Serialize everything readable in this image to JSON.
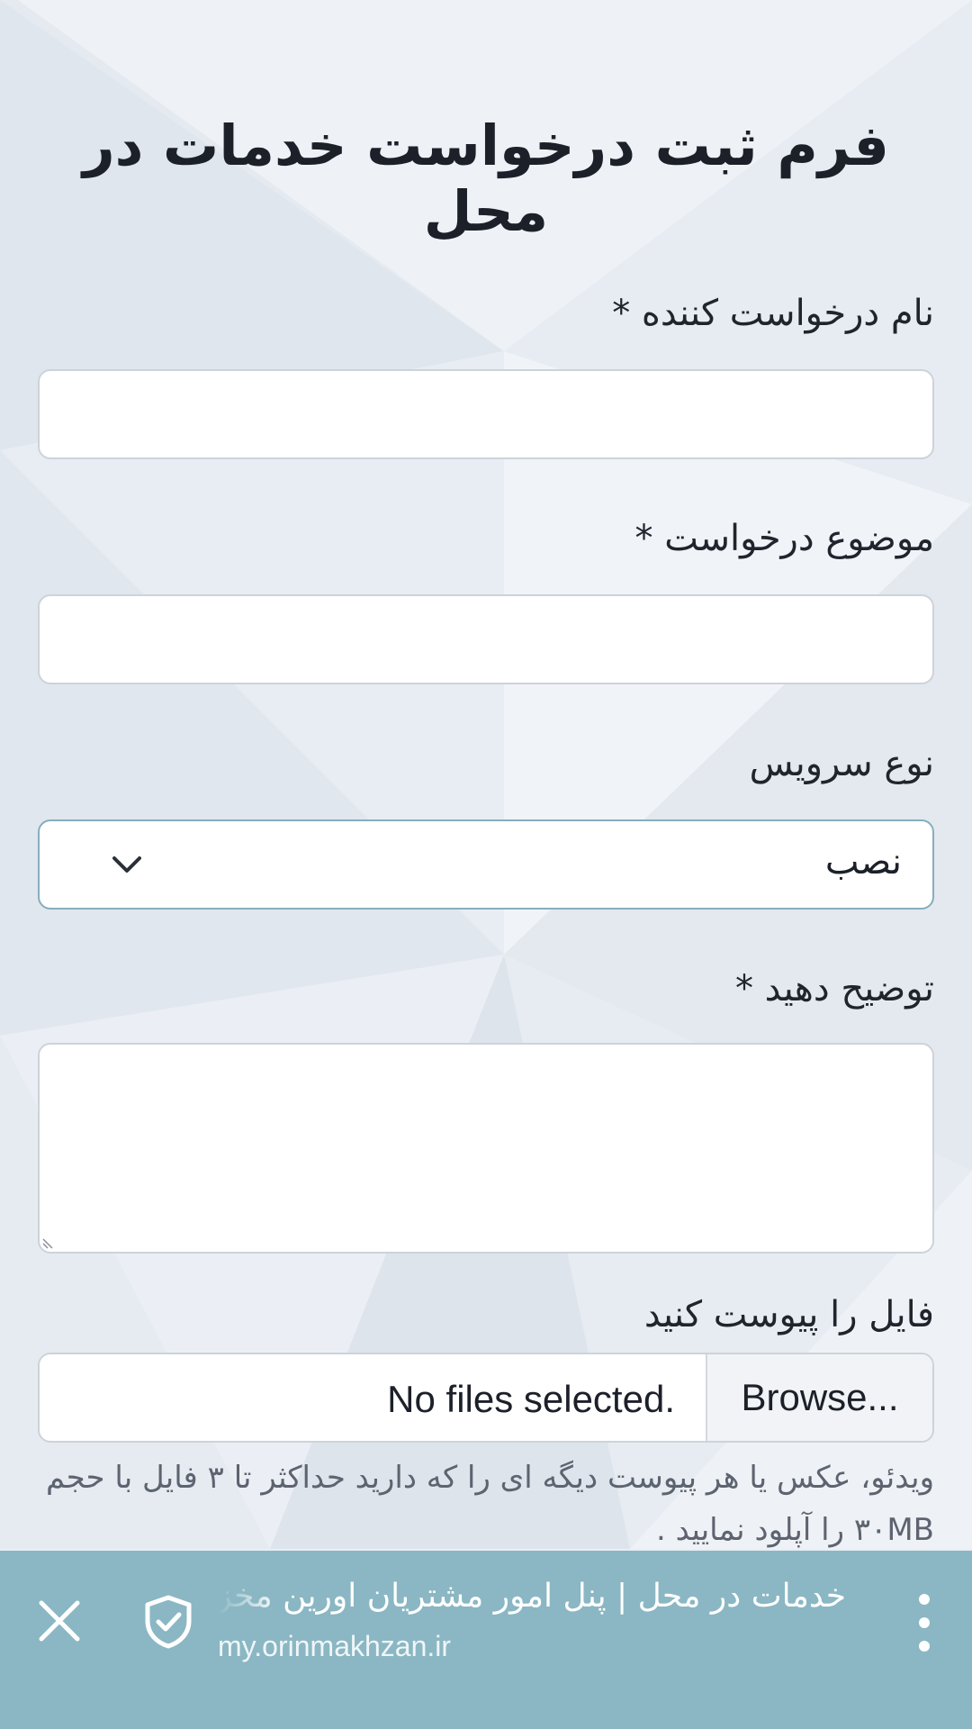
{
  "form": {
    "title": "فرم ثبت درخواست خدمات در محل",
    "requester_name_label": "نام درخواست کننده *",
    "requester_name_value": "",
    "subject_label": "موضوع درخواست *",
    "subject_value": "",
    "service_type_label": "نوع سرویس",
    "service_type_selected": "نصب",
    "description_label": "توضیح دهید *",
    "description_value": "",
    "attach_label": "فایل را پیوست کنید",
    "browse_label": "Browse...",
    "no_file_text": "No files selected.",
    "help_text": "ویدئو، عکس یا هر پیوست دیگه ای را که دارید حداکثر تا ۳ فایل با حجم ۳۰MB را آپلود نمایید ."
  },
  "custom_tab_bar": {
    "page_title": "خدمات در محل | پنل امور مشتریان اورین مخزن",
    "url": "my.orinmakhzan.ir",
    "close_icon": "close-icon",
    "security_icon": "shield-check-icon",
    "menu_icon": "more-vertical-icon",
    "background_color": "#8ab7c3"
  }
}
